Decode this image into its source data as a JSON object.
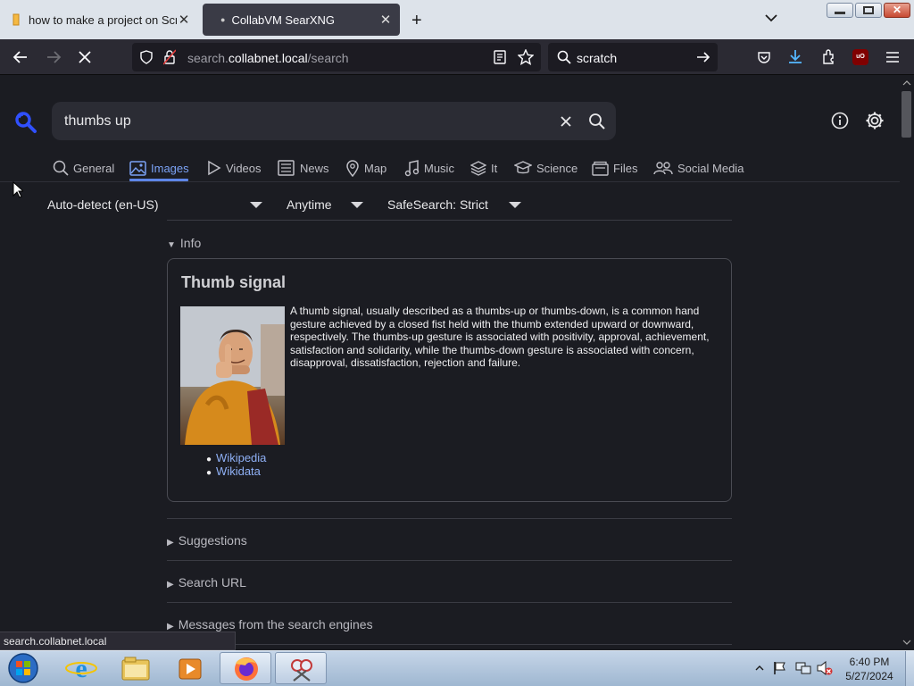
{
  "browser": {
    "tabs": [
      {
        "title": "how to make a project on Scratch",
        "active": false
      },
      {
        "title": "CollabVM SearXNG",
        "active": true
      }
    ],
    "new_tab_label": "+",
    "url_prefix": "search.",
    "url_host": "collabnet.local",
    "url_path": "/search",
    "search_box_value": "scratch",
    "status_url": "search.collabnet.local"
  },
  "searx": {
    "query": "thumbs up",
    "categories": [
      {
        "label": "General",
        "icon": "search-icon"
      },
      {
        "label": "Images",
        "icon": "image-icon",
        "active": true
      },
      {
        "label": "Videos",
        "icon": "play-icon"
      },
      {
        "label": "News",
        "icon": "newspaper-icon"
      },
      {
        "label": "Map",
        "icon": "map-pin-icon"
      },
      {
        "label": "Music",
        "icon": "music-icon"
      },
      {
        "label": "It",
        "icon": "layers-icon"
      },
      {
        "label": "Science",
        "icon": "science-icon"
      },
      {
        "label": "Files",
        "icon": "files-icon"
      },
      {
        "label": "Social Media",
        "icon": "people-icon"
      }
    ],
    "filters": {
      "language": "Auto-detect (en-US)",
      "time": "Anytime",
      "safesearch": "SafeSearch: Strict"
    },
    "info": {
      "section_label": "Info",
      "title": "Thumb signal",
      "text": "A thumb signal, usually described as a thumbs-up or thumbs-down, is a common hand gesture achieved by a closed fist held with the thumb extended upward or downward, respectively. The thumbs-up gesture is associated with positivity, approval, achievement, satisfaction and solidarity, while the thumbs-down gesture is associated with concern, disapproval, dissatisfaction, rejection and failure.",
      "links": [
        "Wikipedia",
        "Wikidata"
      ]
    },
    "sections": [
      "Suggestions",
      "Search URL",
      "Messages from the search engines"
    ]
  },
  "taskbar": {
    "time": "6:40 PM",
    "date": "5/27/2024"
  },
  "colors": {
    "accent": "#5e86e8",
    "page_bg": "#1b1c22",
    "link": "#8fb0f5"
  }
}
